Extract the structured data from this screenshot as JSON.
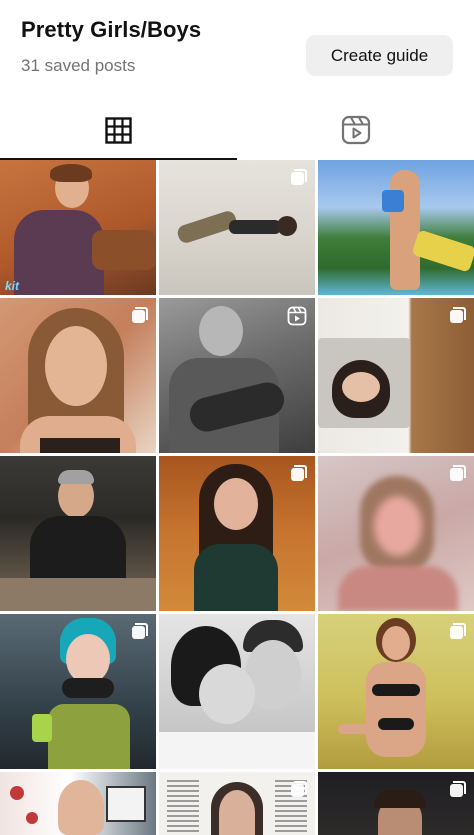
{
  "header": {
    "title": "Pretty Girls/Boys",
    "saved_count": "31 saved posts",
    "create_guide_label": "Create guide"
  },
  "tabs": [
    {
      "name": "grid",
      "icon": "grid-icon",
      "active": true
    },
    {
      "name": "reels",
      "icon": "reels-icon",
      "active": false
    }
  ],
  "colors": {
    "text_primary": "#111111",
    "text_secondary": "#737373",
    "button_bg": "#efefef",
    "tab_indicator": "#111111"
  },
  "posts": [
    {
      "type": "photo",
      "watermark": "kit"
    },
    {
      "type": "carousel",
      "watermark": ""
    },
    {
      "type": "photo",
      "watermark": ""
    },
    {
      "type": "carousel",
      "watermark": ""
    },
    {
      "type": "reel",
      "watermark": ""
    },
    {
      "type": "carousel",
      "watermark": ""
    },
    {
      "type": "photo",
      "watermark": ""
    },
    {
      "type": "carousel",
      "watermark": ""
    },
    {
      "type": "carousel",
      "watermark": ""
    },
    {
      "type": "carousel",
      "watermark": ""
    },
    {
      "type": "photo",
      "watermark": ""
    },
    {
      "type": "carousel",
      "watermark": ""
    },
    {
      "type": "photo",
      "watermark": ""
    },
    {
      "type": "carousel",
      "watermark": ""
    },
    {
      "type": "carousel",
      "watermark": ""
    }
  ]
}
